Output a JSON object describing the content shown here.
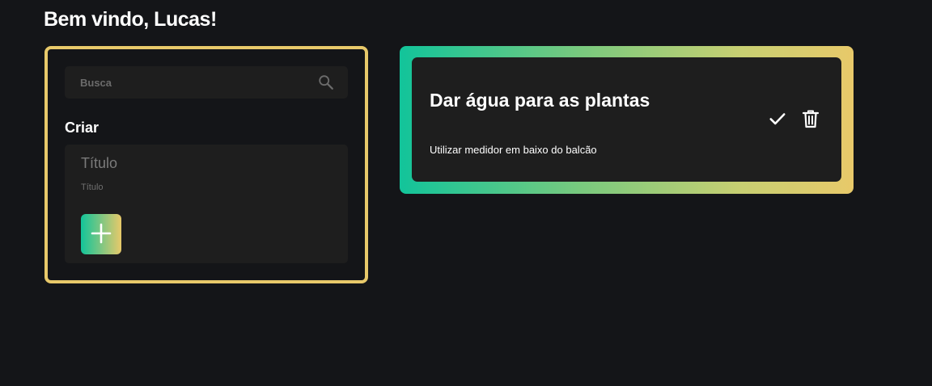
{
  "header": {
    "greeting": "Bem vindo, Lucas!"
  },
  "sidebar": {
    "search": {
      "placeholder": "Busca",
      "value": "",
      "icon": "search-icon"
    },
    "create": {
      "heading": "Criar",
      "title_placeholder": "Título",
      "description_placeholder": "Título",
      "add_icon": "plus-icon"
    }
  },
  "tasks": [
    {
      "title": "Dar água para as plantas",
      "description": "Utilizar medidor em baixo do balcão",
      "icons": [
        "check-icon",
        "trash-icon"
      ]
    }
  ],
  "colors": {
    "background": "#141518",
    "card": "#1e1e1e",
    "accent_gold": "#e8c96a",
    "accent_green": "#12c49a"
  }
}
